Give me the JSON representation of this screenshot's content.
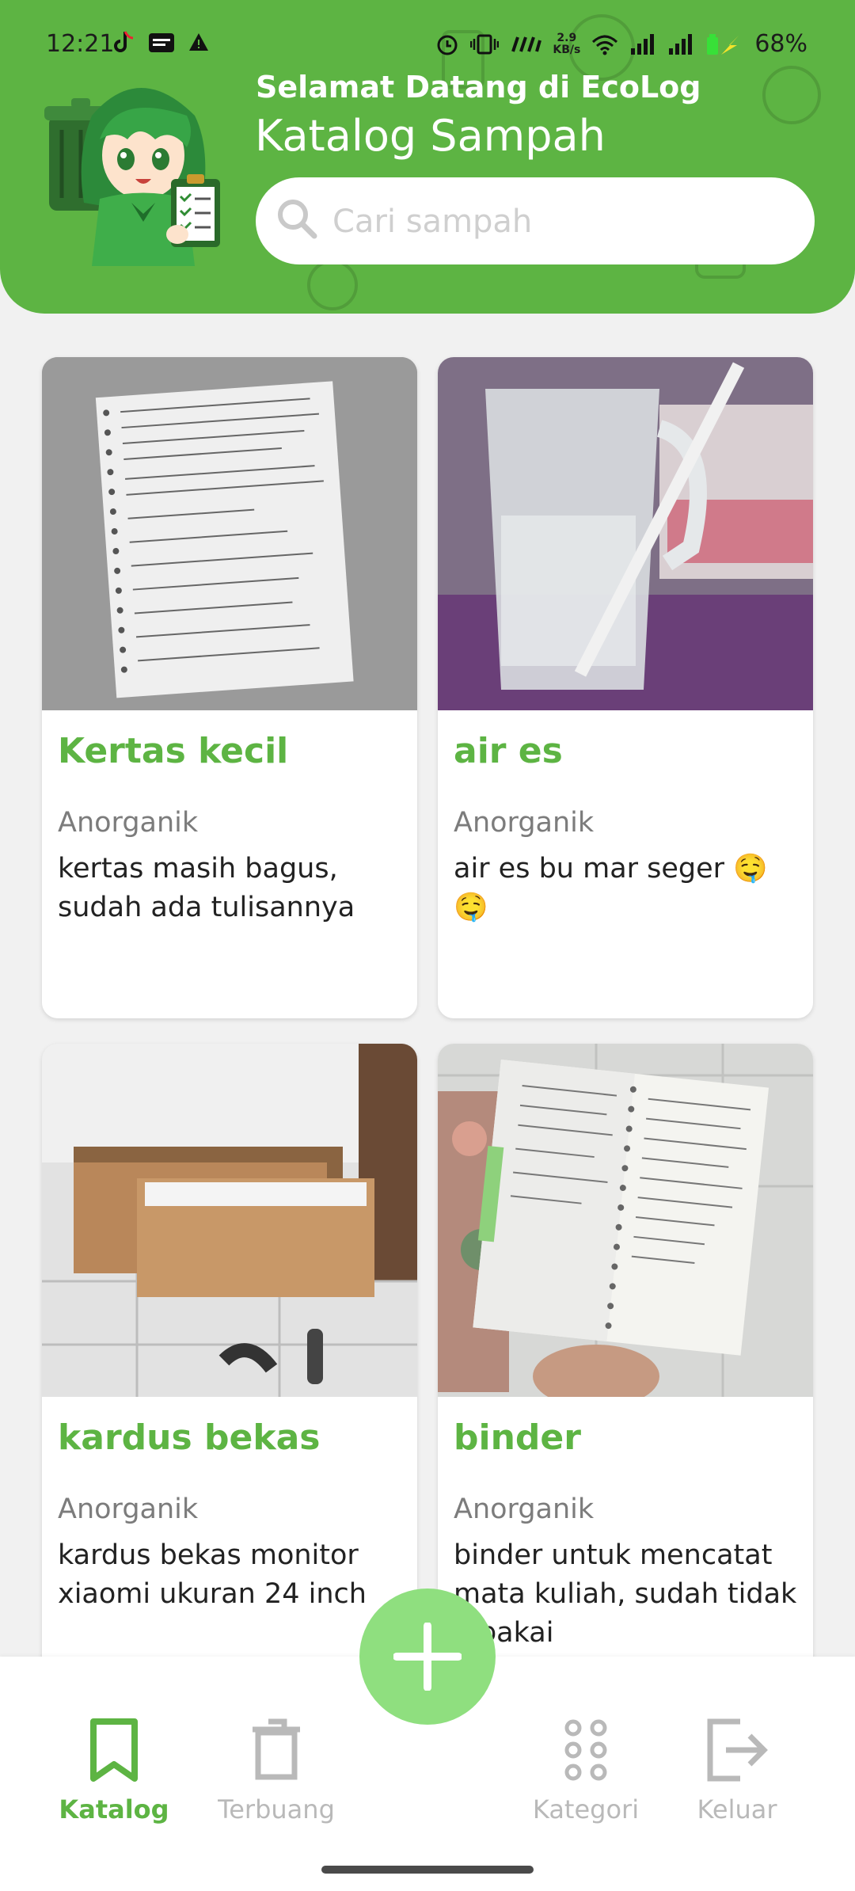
{
  "status": {
    "time": "12:21",
    "speed_top": "2.9",
    "speed_bottom": "KB/s",
    "battery": "68%"
  },
  "header": {
    "welcome": "Selamat Datang di EcoLog",
    "title": "Katalog Sampah"
  },
  "search": {
    "placeholder": "Cari sampah"
  },
  "items": [
    {
      "title": "Kertas kecil",
      "category": "Anorganik",
      "description": "kertas masih bagus, sudah ada tulisannya",
      "photo": "notebook-paper-photo"
    },
    {
      "title": "air es",
      "category": "Anorganik",
      "description": "air es bu mar seger 🤤🤤",
      "photo": "ice-water-glass-photo"
    },
    {
      "title": "kardus bekas",
      "category": "Anorganik",
      "description": "kardus bekas monitor xiaomi ukuran 24 inch",
      "photo": "cardboard-box-photo"
    },
    {
      "title": "binder",
      "category": "Anorganik",
      "description": "binder untuk mencatat mata kuliah, sudah tidak dipakai",
      "photo": "binder-notebook-photo"
    }
  ],
  "nav": {
    "katalog": "Katalog",
    "terbuang": "Terbuang",
    "kategori": "Kategori",
    "keluar": "Keluar"
  },
  "colors": {
    "brand_green": "#5db443",
    "fab_green": "#8fdf7f",
    "inactive_gray": "#b9b9b9"
  }
}
